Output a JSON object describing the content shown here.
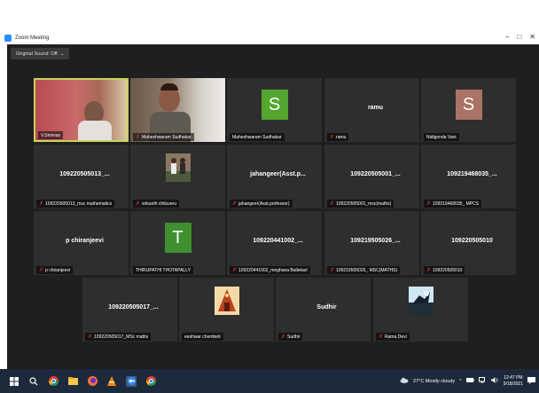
{
  "window": {
    "title": "Zoom Meeting",
    "controls": [
      "–",
      "□",
      "✕"
    ]
  },
  "toolbar": {
    "original_sound": "Original Sound: Off",
    "dropdown": "⌄"
  },
  "colors": {
    "mic_muted": "#e0302b",
    "active_speaker": "#c6d45a",
    "zoom_blue": "#2d8cff"
  },
  "tiles": [
    {
      "kind": "video1",
      "label": "V.Srinivas",
      "muted": false
    },
    {
      "kind": "video2",
      "label": "Maheshwaram Sudhakar",
      "muted": true
    },
    {
      "kind": "avatar",
      "letter": "S",
      "color": "#55a630",
      "label": "Maheshwaram Sudhakar",
      "muted": false
    },
    {
      "kind": "name",
      "name": "ramu",
      "label": "ramu",
      "muted": true
    },
    {
      "kind": "avatar",
      "letter": "S",
      "color": "#a97366",
      "label": "Nidigonda Vani",
      "muted": false
    },
    {
      "kind": "name",
      "name": "109220505013_...",
      "label": "109220505013_msc mathematics",
      "muted": true
    },
    {
      "kind": "photo",
      "photo": "two-people",
      "label": "srikanth chiluveru",
      "muted": true
    },
    {
      "kind": "name",
      "name": "jahangeer(Asst.p...",
      "label": "jahangeer(Asst.professor)",
      "muted": true
    },
    {
      "kind": "name",
      "name": "109220505001_...",
      "label": "109220505001_msc(maths)",
      "muted": true
    },
    {
      "kind": "name",
      "name": "109219468035_...",
      "label": "109219468035_ MPCS",
      "muted": true
    },
    {
      "kind": "name",
      "name": "p chiranjeevi",
      "label": "p chiranjeevi",
      "muted": true
    },
    {
      "kind": "avatar",
      "letter": "T",
      "color": "#3f8f2f",
      "label": "THIRUPATHI THOTAPALLY",
      "muted": false
    },
    {
      "kind": "name",
      "name": "109220441002_...",
      "label": "109220441002_meghana Ballekari",
      "muted": true
    },
    {
      "kind": "name",
      "name": "109219505026_...",
      "label": "109219505026_ MSC(MATHS)",
      "muted": true
    },
    {
      "kind": "name",
      "name": "109220505010",
      "label": "109220505010",
      "muted": true
    },
    {
      "kind": "name",
      "name": "109220505017_...",
      "label": "109220505017_MSc maths",
      "muted": true
    },
    {
      "kind": "photo",
      "photo": "temple",
      "label": "eeshwar chembeti",
      "muted": false
    },
    {
      "kind": "name",
      "name": "Sudhir",
      "label": "Sudhir",
      "muted": true
    },
    {
      "kind": "photo",
      "photo": "bird",
      "label": "Rama Devi",
      "muted": true
    }
  ],
  "taskbar": {
    "apps": [
      "windows-start",
      "search",
      "chrome",
      "file-explorer",
      "firefox",
      "vlc",
      "zoom",
      "chrome-2"
    ],
    "weather": "27°C  Mostly cloudy",
    "time": "12:47 PM",
    "date": "9/18/2021"
  }
}
